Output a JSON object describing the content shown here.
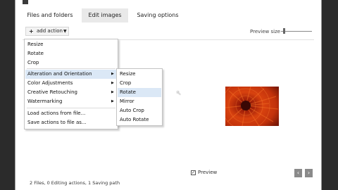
{
  "tabs": [
    {
      "label": "Files and folders"
    },
    {
      "label": "Edit images"
    },
    {
      "label": "Saving options"
    }
  ],
  "toolbar": {
    "add_action_label": "add action",
    "preview_size_label": "Preview size"
  },
  "menu": {
    "items": [
      {
        "label": "Resize"
      },
      {
        "label": "Rotate"
      },
      {
        "label": "Crop"
      },
      {
        "label": "Alteration and Orientation"
      },
      {
        "label": "Color Adjustments"
      },
      {
        "label": "Creative Retouching"
      },
      {
        "label": "Watermarking"
      },
      {
        "label": "Load actions from file..."
      },
      {
        "label": "Save actions to file as..."
      }
    ],
    "highlighted": "Alteration and Orientation"
  },
  "submenu": {
    "items": [
      {
        "label": "Resize"
      },
      {
        "label": "Crop"
      },
      {
        "label": "Rotate"
      },
      {
        "label": "Mirror"
      },
      {
        "label": "Auto Crop"
      },
      {
        "label": "Auto Rotate"
      }
    ],
    "highlighted": "Rotate"
  },
  "preview": {
    "label": "Preview",
    "checked": true
  },
  "status": {
    "text": "2 Files, 0 Editing actions, 1 Saving path"
  },
  "colors": {
    "accent_highlight": "#dbe8f6",
    "nav_button": "#8a8a8a"
  }
}
